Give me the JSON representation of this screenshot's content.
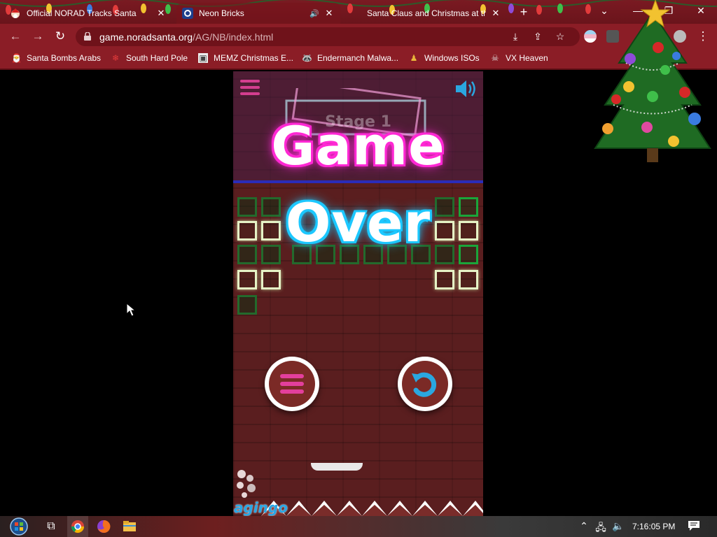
{
  "browser": {
    "tabs": [
      {
        "title": "Official NORAD Tracks Santa",
        "favicon": "santa-favicon",
        "active": false
      },
      {
        "title": "Neon Bricks",
        "favicon": "norad-favicon",
        "active": true,
        "audio": true
      },
      {
        "title": "Santa Claus and Christmas at the",
        "favicon": "santa-favicon",
        "active": false
      }
    ],
    "new_tab_label": "+",
    "close_glyph": "✕",
    "url_host": "game.noradsanta.org",
    "url_path": "/AG/NB/index.html",
    "icons": [
      "back-icon",
      "forward-icon",
      "reload-icon",
      "lock-icon",
      "download-icon",
      "share-icon",
      "star-icon",
      "profile-icon",
      "more-icon"
    ],
    "window_controls": {
      "chevron": "⌄",
      "minimize": "—",
      "restore": "❐",
      "close": "✕"
    },
    "bookmarks": [
      {
        "label": "Santa Bombs Arabs",
        "icon": "santa-icon"
      },
      {
        "label": "South Hard Pole",
        "icon": "snowflake-icon"
      },
      {
        "label": "MEMZ Christmas E...",
        "icon": "image-icon"
      },
      {
        "label": "Endermanch Malwa...",
        "icon": "raccoon-icon"
      },
      {
        "label": "Windows ISOs",
        "icon": "figure-icon"
      },
      {
        "label": "VX Heaven",
        "icon": "vx-icon"
      }
    ]
  },
  "game": {
    "stage_label": "Stage 1",
    "title_line1": "Game",
    "title_line2": "Over",
    "logo": "agingo",
    "colors": {
      "pink": "#ff2ad4",
      "cyan": "#1ec8ff",
      "brick_green": "#1aa53a"
    },
    "buttons": [
      "menu-button",
      "restart-button"
    ]
  },
  "taskbar": {
    "clock": "7:16:05 PM",
    "apps": [
      "start-orb",
      "task-view-icon",
      "chrome-icon",
      "firefox-icon",
      "file-explorer-icon"
    ]
  }
}
